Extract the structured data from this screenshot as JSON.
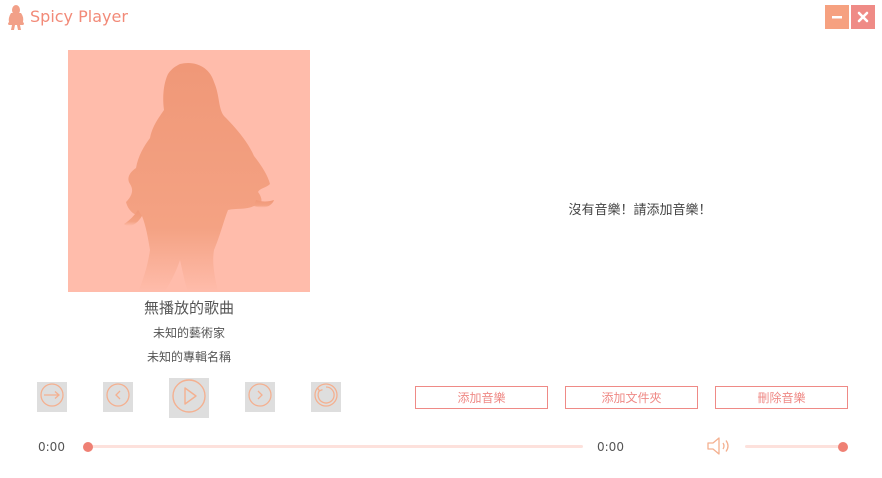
{
  "window": {
    "title": "Spicy Player",
    "accent_color": "#ef8a86",
    "minimize_icon": "minimize-icon",
    "close_icon": "close-icon"
  },
  "now_playing": {
    "song_title": "無播放的歌曲",
    "artist": "未知的藝術家",
    "album": "未知的專輯名稱"
  },
  "playlist": {
    "empty_message": "沒有音樂！請添加音樂！"
  },
  "controls": {
    "shuffle_icon": "shuffle-icon",
    "previous_icon": "previous-icon",
    "play_icon": "play-icon",
    "next_icon": "next-icon",
    "repeat_icon": "repeat-icon"
  },
  "actions": {
    "add_music": "添加音樂",
    "add_folder": "添加文件夾",
    "delete_music": "刪除音樂"
  },
  "progress": {
    "current_time": "0:00",
    "total_time": "0:00",
    "position": 0
  },
  "volume": {
    "icon": "volume-icon",
    "level": 1.0
  }
}
